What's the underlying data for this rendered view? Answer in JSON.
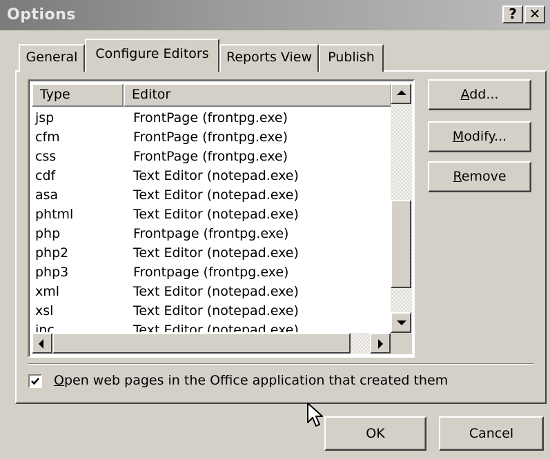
{
  "window": {
    "title": "Options",
    "help_label": "?",
    "close_label": "✕"
  },
  "tabs": [
    {
      "label": "General",
      "selected": false
    },
    {
      "label": "Configure Editors",
      "selected": true
    },
    {
      "label": "Reports View",
      "selected": false
    },
    {
      "label": "Publish",
      "selected": false
    }
  ],
  "editor_list": {
    "columns": {
      "type": "Type",
      "editor": "Editor"
    },
    "rows": [
      {
        "type": "jsp",
        "editor": "FrontPage (frontpg.exe)"
      },
      {
        "type": "cfm",
        "editor": "FrontPage (frontpg.exe)"
      },
      {
        "type": "css",
        "editor": "FrontPage (frontpg.exe)"
      },
      {
        "type": "cdf",
        "editor": "Text Editor (notepad.exe)"
      },
      {
        "type": "asa",
        "editor": "Text Editor (notepad.exe)"
      },
      {
        "type": "phtml",
        "editor": "Text Editor (notepad.exe)"
      },
      {
        "type": "php",
        "editor": "Frontpage (frontpg.exe)"
      },
      {
        "type": "php2",
        "editor": "Text Editor (notepad.exe)"
      },
      {
        "type": "php3",
        "editor": "Frontpage (frontpg.exe)"
      },
      {
        "type": "xml",
        "editor": "Text Editor (notepad.exe)"
      },
      {
        "type": "xsl",
        "editor": "Text Editor (notepad.exe)"
      },
      {
        "type": "inc",
        "editor": "Text Editor (notepad.exe)"
      }
    ]
  },
  "side_buttons": {
    "add": {
      "before": "",
      "access": "A",
      "after": "dd..."
    },
    "modify": {
      "before": "",
      "access": "M",
      "after": "odify..."
    },
    "remove": {
      "before": "",
      "access": "R",
      "after": "emove"
    }
  },
  "checkbox": {
    "checked": true,
    "label_access": "O",
    "label_rest": "pen web pages in the Office application that created them"
  },
  "footer": {
    "ok_label": "OK",
    "cancel_label": "Cancel"
  },
  "colors": {
    "face": "#d4d0c8",
    "title_gradient_start": "#7b7b7b",
    "title_text": "#e8e8e8"
  }
}
